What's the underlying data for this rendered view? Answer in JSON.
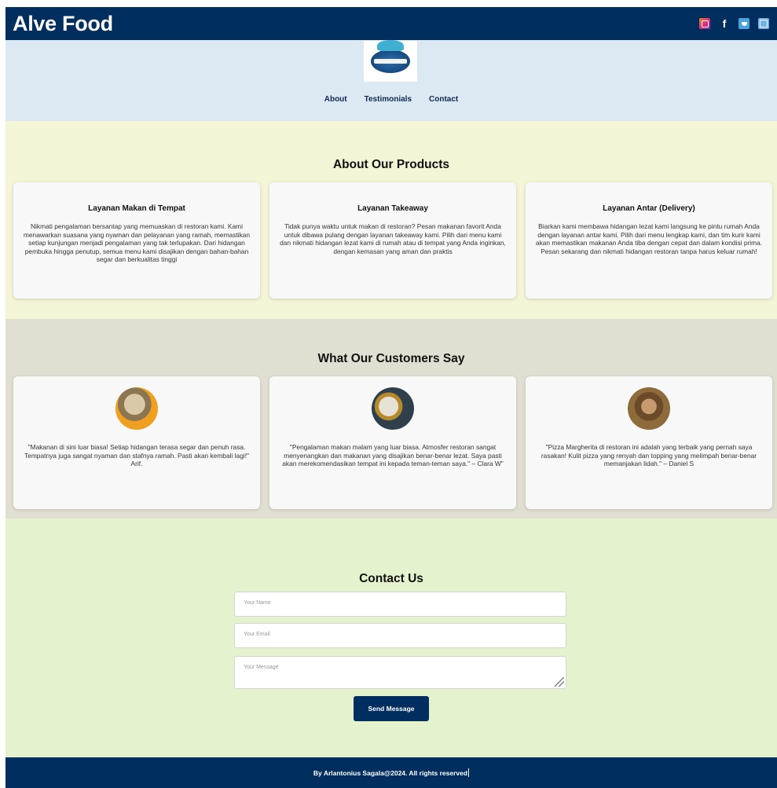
{
  "header": {
    "brand": "Alve Food",
    "social_icons": [
      "instagram-icon",
      "facebook-icon",
      "twitter-icon",
      "app-icon"
    ]
  },
  "nav": {
    "items": [
      "About",
      "Testimonials",
      "Contact"
    ]
  },
  "about": {
    "title": "About Our Products",
    "cards": [
      {
        "title": "Layanan Makan di Tempat",
        "text": "Nikmati pengalaman bersantap yang memuaskan di restoran kami. Kami menawarkan suasana yang nyaman dan pelayanan yang ramah, memastikan setiap kunjungan menjadi pengalaman yang tak terlupakan. Dari hidangan pembuka hingga penutup, semua menu kami disajikan dengan bahan-bahan segar dan berkualitas tinggi"
      },
      {
        "title": "Layanan Takeaway",
        "text": "Tidak punya waktu untuk makan di restoran? Pesan makanan favorit Anda untuk dibawa pulang dengan layanan takeaway kami. Pilih dari menu kami dan nikmati hidangan lezat kami di rumah atau di tempat yang Anda inginkan, dengan kemasan yang aman dan praktis"
      },
      {
        "title": "Layanan Antar (Delivery)",
        "text": "Biarkan kami membawa hidangan lezat kami langsung ke pintu rumah Anda dengan layanan antar kami. Pilih dari menu lengkap kami, dan tim kurir kami akan memastikan makanan Anda tiba dengan cepat dan dalam kondisi prima. Pesan sekarang dan nikmati hidangan restoran tanpa harus keluar rumah!"
      }
    ]
  },
  "testimonials": {
    "title": "What Our Customers Say",
    "items": [
      {
        "quote": "\"Makanan di sini luar biasa! Setiap hidangan terasa segar dan penuh rasa. Tempatnya juga sangat nyaman dan stafnya ramah. Pasti akan kembali lagi!\" Arif."
      },
      {
        "quote": "\"Pengalaman makan malam yang luar biasa. Atmosfer restoran sangat menyenangkan dan makanan yang disajikan benar-benar lezat. Saya pasti akan merekomendasikan tempat ini kepada teman-teman saya.\" – Clara W\""
      },
      {
        "quote": "\"Pizza Margherita di restoran ini adalah yang terbaik yang pernah saya rasakan! Kulit pizza yang renyah dan topping yang melimpah benar-benar memanjakan lidah.\" – Daniel S"
      }
    ]
  },
  "contact": {
    "title": "Contact Us",
    "name_placeholder": "Your Name",
    "email_placeholder": "Your Email",
    "message_placeholder": "Your Message",
    "send_label": "Send Message"
  },
  "footer": {
    "text": "By Arlantonius Sagala@2024. All rights reserved"
  }
}
